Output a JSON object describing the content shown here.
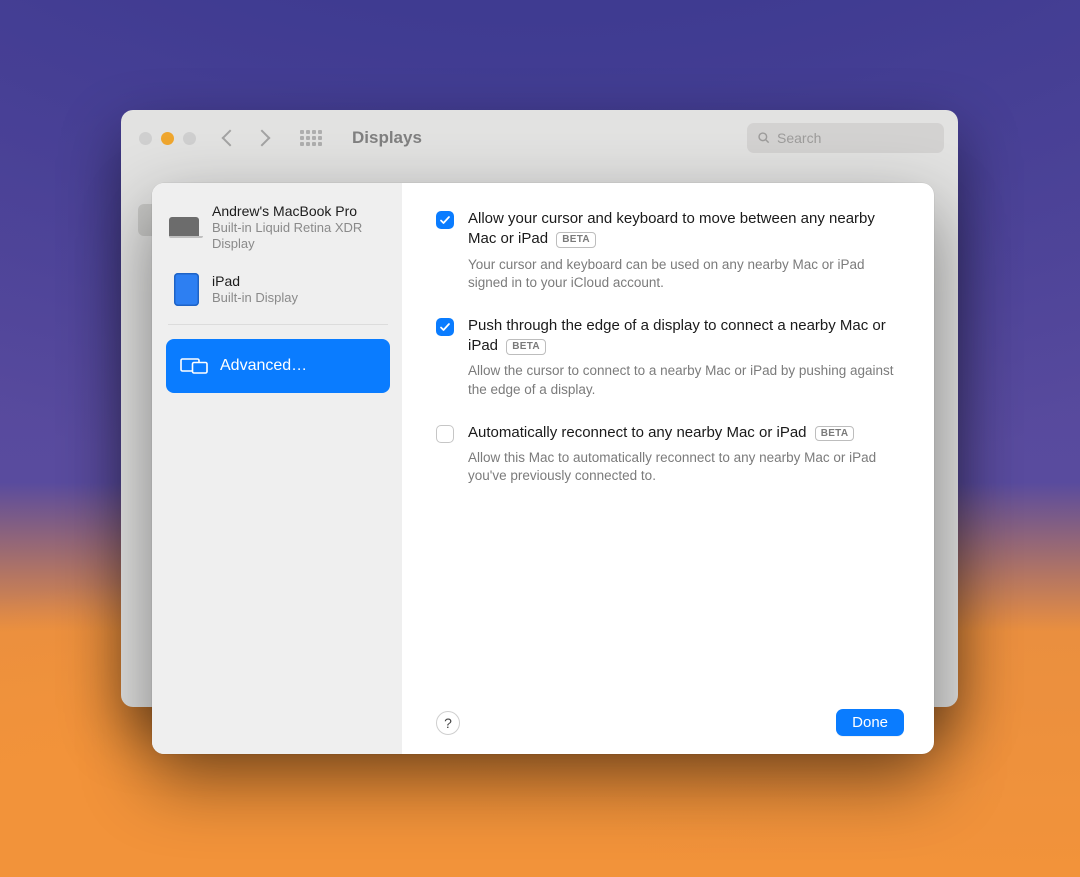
{
  "window": {
    "title": "Displays",
    "search_placeholder": "Search"
  },
  "sidebar": {
    "devices": [
      {
        "name": "Andrew's MacBook Pro",
        "sub": "Built-in Liquid Retina XDR Display"
      },
      {
        "name": "iPad",
        "sub": "Built-in Display"
      }
    ],
    "advanced_label": "Advanced…"
  },
  "options": [
    {
      "checked": true,
      "label": "Allow your cursor and keyboard to move between any nearby Mac or iPad",
      "badge": "BETA",
      "desc": "Your cursor and keyboard can be used on any nearby Mac or iPad signed in to your iCloud account."
    },
    {
      "checked": true,
      "label": "Push through the edge of a display to connect a nearby Mac or iPad",
      "badge": "BETA",
      "desc": "Allow the cursor to connect to a nearby Mac or iPad by pushing against the edge of a display."
    },
    {
      "checked": false,
      "label": "Automatically reconnect to any nearby Mac or iPad",
      "badge": "BETA",
      "desc": "Allow this Mac to automatically reconnect to any nearby Mac or iPad you've previously connected to."
    }
  ],
  "footer": {
    "help": "?",
    "done": "Done"
  }
}
